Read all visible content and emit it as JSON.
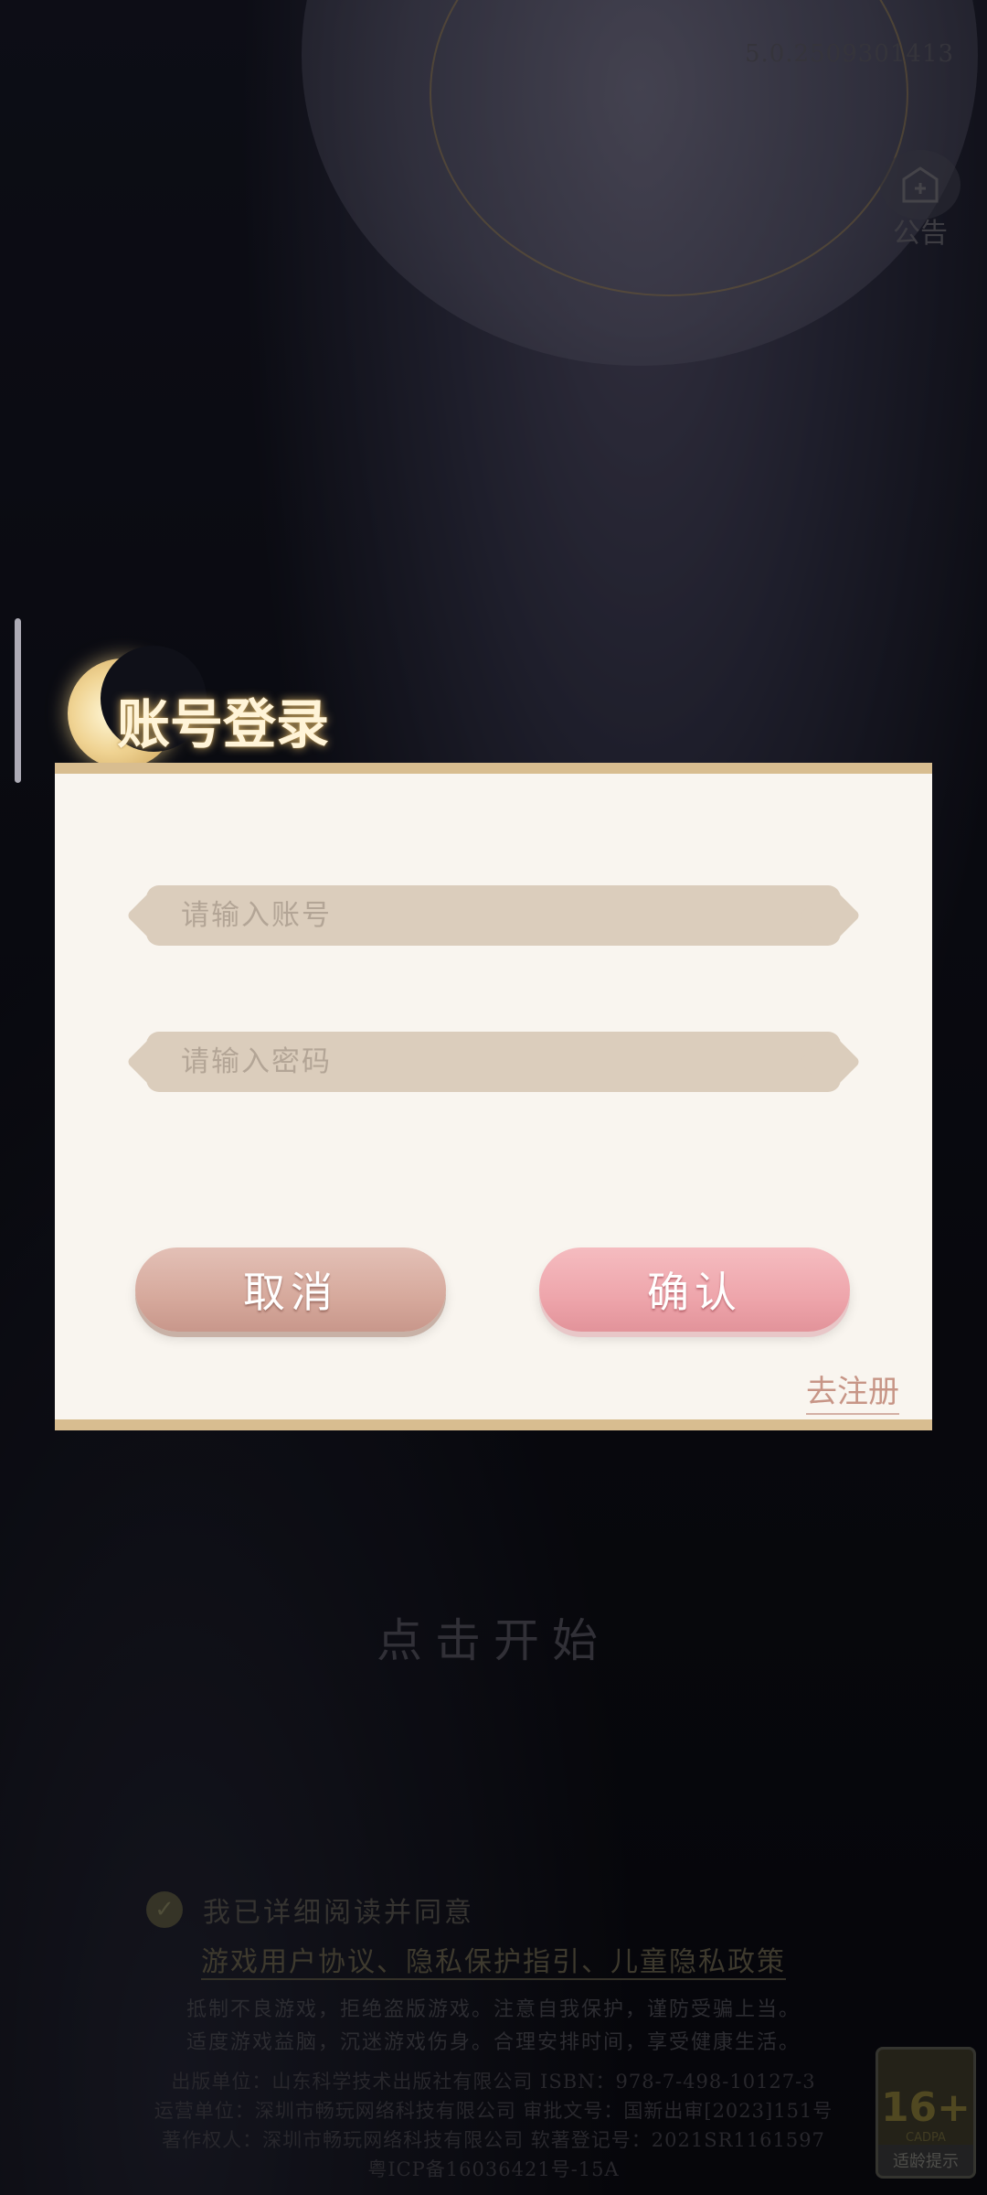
{
  "version": "5.0.2509301413",
  "notice": {
    "label": "公告",
    "icon": "notice-icon"
  },
  "login_dialog": {
    "title": "账号登录",
    "account_placeholder": "请输入账号",
    "password_placeholder": "请输入密码",
    "cancel_label": "取消",
    "confirm_label": "确认",
    "register_link": "去注册"
  },
  "background_ui": {
    "start_text": "点击开始",
    "agree_text": "我已详细阅读并同意",
    "agreement_links": "游戏用户协议、隐私保护指引、儿童隐私政策",
    "notice_line1": "抵制不良游戏，拒绝盗版游戏。注意自我保护，谨防受骗上当。",
    "notice_line2": "适度游戏益脑，沉迷游戏伤身。合理安排时间，享受健康生活。",
    "pub_line1": "出版单位：山东科学技术出版社有限公司 ISBN：978-7-498-10127-3",
    "pub_line2": "运营单位：深圳市畅玩网络科技有限公司  审批文号：国新出审[2023]151号",
    "pub_line3": "著作权人：深圳市畅玩网络科技有限公司 软著登记号：2021SR1161597",
    "pub_line4": "粤ICP备16036421号-15A"
  },
  "age_rating": {
    "number": "16+",
    "org": "CADPA",
    "label": "适龄提示"
  },
  "colors": {
    "dialog_bg": "#f9f5ef",
    "dialog_border": "#d8bd90",
    "cancel_button": "#d6a99c",
    "confirm_button": "#eea5ab",
    "register_link": "#c79586"
  }
}
